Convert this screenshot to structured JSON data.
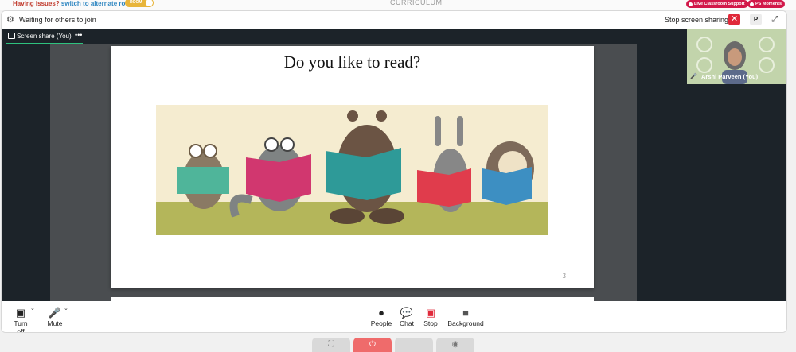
{
  "top": {
    "issue_text": "Having issues?",
    "issue_link": "switch to alternate room",
    "room_toggle": "ROOM",
    "center_title": "CURRICULUM",
    "pills": [
      "Live Classroom Support",
      "PS Moments"
    ]
  },
  "header": {
    "waiting": "Waiting for others to join",
    "stop_sharing": "Stop screen sharing",
    "p_label": "P"
  },
  "tab": {
    "label": "Screen share (You)",
    "more": "•••"
  },
  "slide": {
    "title": "Do you like to read?",
    "page_number": "3"
  },
  "participant": {
    "name": "Arshi Parveen (You)"
  },
  "toolbar": {
    "turn_off": "Turn off",
    "mute": "Mute",
    "people": "People",
    "chat": "Chat",
    "stop": "Stop",
    "background": "Background"
  },
  "colors": {
    "accent_red": "#e0293a",
    "tab_green": "#2ec27e",
    "dark": "#1c2329",
    "pill": "#d2184a"
  }
}
